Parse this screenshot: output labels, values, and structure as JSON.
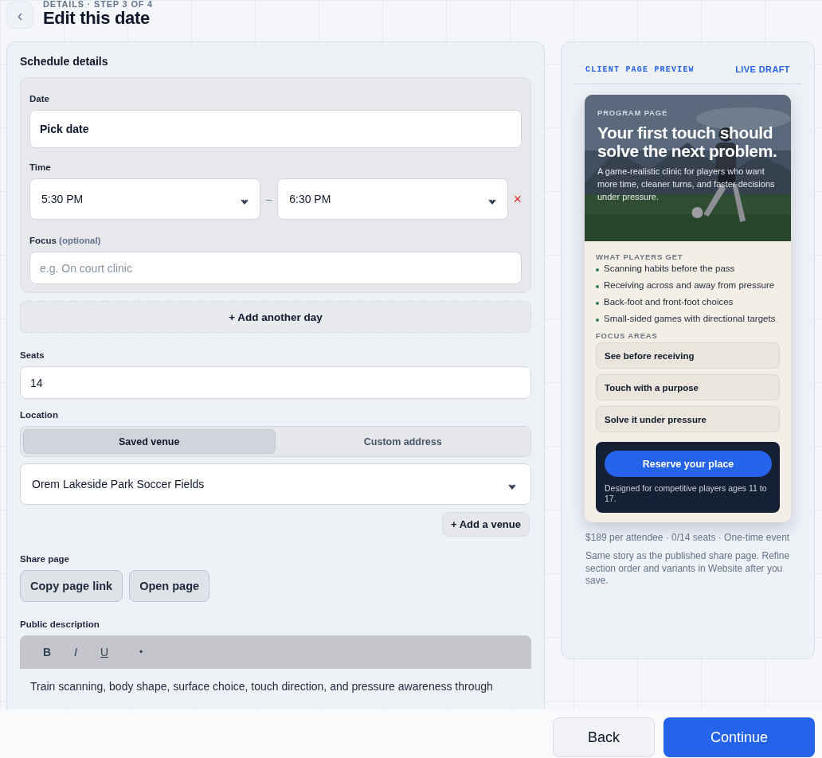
{
  "header": {
    "back_icon": "‹",
    "eyebrow": "DETAILS · STEP 3 OF 4",
    "title": "Edit this date"
  },
  "schedule": {
    "title": "Schedule details",
    "date": {
      "label": "Date",
      "value": "Pick date"
    },
    "time": {
      "label": "Time",
      "start": "5:30 PM",
      "separator": "–",
      "end": "6:30 PM",
      "remove": "×"
    },
    "focus": {
      "label": "Focus",
      "hint": "(optional)",
      "placeholder": "e.g. On court clinic"
    },
    "add_day": "+ Add another day"
  },
  "seats": {
    "label": "Seats",
    "value": "14"
  },
  "location": {
    "label": "Location",
    "options": [
      {
        "label": "Saved venue",
        "selected": true
      },
      {
        "label": "Custom address",
        "selected": false
      }
    ],
    "venue": "Orem Lakeside Park Soccer Fields",
    "add_venue": "+ Add a venue"
  },
  "share": {
    "label": "Share page",
    "buttons": [
      "Copy page link",
      "Open page"
    ]
  },
  "description": {
    "label": "Public description",
    "toolbar": [
      {
        "kind": "bold",
        "label": "B"
      },
      {
        "kind": "italic",
        "label": "I"
      },
      {
        "kind": "underline",
        "label": "U"
      },
      {
        "kind": "bullet",
        "label": "•"
      }
    ],
    "text": "Train scanning, body shape, surface choice, touch direction, and pressure awareness through"
  },
  "preview": {
    "title": "CLIENT PAGE PREVIEW",
    "badge": "LIVE DRAFT",
    "hero": {
      "kind": "picture",
      "eyebrow": "PROGRAM PAGE",
      "headline": "Your first touch should solve the next problem.",
      "lede": "A game-realistic clinic for players who want more time, cleaner turns, and faster decisions under pressure."
    },
    "benefits_title": "WHAT PLAYERS GET",
    "benefits": [
      "Scanning habits before the pass",
      "Receiving across and away from pressure",
      "Back-foot and front-foot choices",
      "Small-sided games with directional targets"
    ],
    "focus_title": "FOCUS AREAS",
    "focus_areas": [
      "See before receiving",
      "Touch with a purpose",
      "Solve it under pressure"
    ],
    "cta": {
      "button": "Reserve your place",
      "note": "Designed for competitive players ages 11 to 17."
    },
    "meta": "$189 per attendee · 0/14 seats · One-time event",
    "note": "Same story as the published share page. Refine section order and variants in Website after you save."
  },
  "footer": {
    "back": "Back",
    "continue": "Continue"
  }
}
